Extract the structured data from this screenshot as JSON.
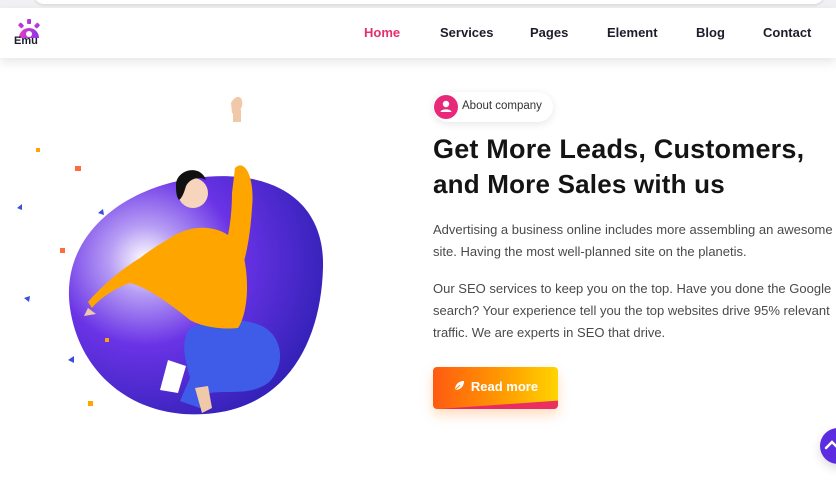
{
  "brand": {
    "logo_text": "Emu",
    "logo_icon": "gear-icon"
  },
  "nav": {
    "items": [
      {
        "label": "Home",
        "active": true
      },
      {
        "label": "Services",
        "active": false
      },
      {
        "label": "Pages",
        "active": false
      },
      {
        "label": "Element",
        "active": false
      },
      {
        "label": "Blog",
        "active": false
      },
      {
        "label": "Contact",
        "active": false
      }
    ]
  },
  "hero": {
    "badge": {
      "icon": "user-icon",
      "label": "About company"
    },
    "headline_bold": "Get More Leads, Customers,",
    "headline_regular": "and More Sales with us",
    "paragraph_1": "Advertising a business online includes more assembling an awesome site. Having the most well-planned site on the planetis.",
    "paragraph_2": "Our SEO services to keep you on the top. Have you done the Google search? Your experience tell you the top websites drive 95% relevant traffic. We are experts in SEO that drive.",
    "cta": {
      "label": "Read more",
      "icon": "leaf-icon"
    }
  },
  "scroll_button": {
    "icon": "chevron-up-icon"
  },
  "colors": {
    "accent": "#e5306c",
    "cta_start": "#ff5a12",
    "cta_end": "#ffd400",
    "blob": "#5b2ce0",
    "shirt": "#ffa500"
  }
}
